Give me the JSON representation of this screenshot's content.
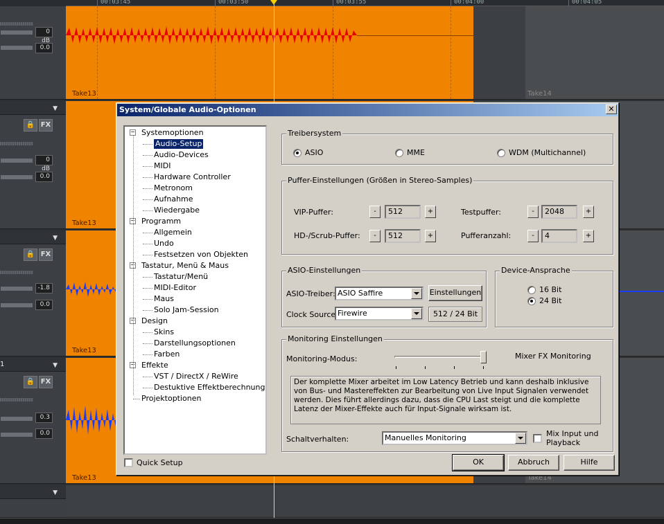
{
  "daw": {
    "ruler": [
      "00:03:45",
      "00:03:50",
      "00:03:55",
      "00:04:00",
      "00:04:05"
    ],
    "tracks": [
      {
        "label": "",
        "val1": "0 dB",
        "val2": "0.0",
        "clip": "Take13",
        "clip2": "Take14"
      },
      {
        "label": "",
        "val1": "0 dB",
        "val2": "0.0",
        "clip": "Take13",
        "clip2": ""
      },
      {
        "label": "",
        "val1": "-1.8",
        "val2": "0.0",
        "clip": "Take13",
        "clip2": ""
      },
      {
        "label": "1",
        "val1": "0.3",
        "val2": "0.0",
        "clip": "Take13",
        "clip2": "Take14"
      }
    ],
    "lock_icon": "lock-icon",
    "fx_label": "FX",
    "colors": {
      "clip": "#f08300",
      "waveform_red": "#e80000",
      "waveform_blue": "#1a3cff"
    }
  },
  "dialog": {
    "title": "System/Globale Audio-Optionen",
    "close": "✕",
    "tree": [
      {
        "label": "Systemoptionen",
        "level": 0,
        "toggle": "−"
      },
      {
        "label": "Audio-Setup",
        "level": 1,
        "selected": true
      },
      {
        "label": "Audio-Devices",
        "level": 1
      },
      {
        "label": "MIDI",
        "level": 1
      },
      {
        "label": "Hardware Controller",
        "level": 1
      },
      {
        "label": "Metronom",
        "level": 1
      },
      {
        "label": "Aufnahme",
        "level": 1
      },
      {
        "label": "Wiedergabe",
        "level": 1
      },
      {
        "label": "Programm",
        "level": 0,
        "toggle": "−"
      },
      {
        "label": "Allgemein",
        "level": 1
      },
      {
        "label": "Undo",
        "level": 1
      },
      {
        "label": "Festsetzen von Objekten",
        "level": 1
      },
      {
        "label": "Tastatur, Menü & Maus",
        "level": 0,
        "toggle": "−"
      },
      {
        "label": "Tastatur/Menü",
        "level": 1
      },
      {
        "label": "MIDI-Editor",
        "level": 1
      },
      {
        "label": "Maus",
        "level": 1
      },
      {
        "label": "Solo Jam-Session",
        "level": 1
      },
      {
        "label": "Design",
        "level": 0,
        "toggle": "−"
      },
      {
        "label": "Skins",
        "level": 1
      },
      {
        "label": "Darstellungsoptionen",
        "level": 1
      },
      {
        "label": "Farben",
        "level": 1
      },
      {
        "label": "Effekte",
        "level": 0,
        "toggle": "−"
      },
      {
        "label": "VST / DirectX / ReWire",
        "level": 1
      },
      {
        "label": "Destuktive Effektberechnung",
        "level": 1
      },
      {
        "label": "Projektoptionen",
        "level": 0
      }
    ],
    "quick_setup": "Quick Setup",
    "treiber": {
      "title": "Treibersystem",
      "asio": "ASIO",
      "mme": "MME",
      "wdm": "WDM (Multichannel)",
      "selected": "ASIO"
    },
    "puffer": {
      "title": "Puffer-Einstellungen (Größen in Stereo-Samples)",
      "vip_label": "VIP-Puffer:",
      "vip_value": "512",
      "hd_label": "HD-/Scrub-Puffer:",
      "hd_value": "512",
      "test_label": "Testpuffer:",
      "test_value": "2048",
      "anzahl_label": "Pufferanzahl:",
      "anzahl_value": "4",
      "minus": "-",
      "plus": "+"
    },
    "asio": {
      "title": "ASIO-Einstellungen",
      "treiber_label": "ASIO-Treiber:",
      "treiber_value": "ASIO Saffire",
      "einstellungen": "Einstellungen",
      "clock_label": "Clock Source:",
      "clock_value": "Firewire",
      "info": "512 / 24 Bit"
    },
    "device": {
      "title": "Device-Ansprache",
      "bit16": "16 Bit",
      "bit24": "24 Bit",
      "selected": "24 Bit"
    },
    "monitoring": {
      "title": "Monitoring Einstellungen",
      "modus_label": "Monitoring-Modus:",
      "modus_value": "Mixer FX Monitoring",
      "level": 1.0,
      "description": "Der komplette Mixer arbeitet im Low Latency Betrieb und kann deshalb inklusive von Bus- und Mastereffekten zur Bearbeitung von Live Input Signalen verwendet werden. Dies führt allerdings dazu, dass die CPU Last steigt und die komplette Latenz der Mixer-Effekte auch für Input-Signale wirksam ist.",
      "schalt_label": "Schaltverhalten:",
      "schalt_value": "Manuelles Monitoring",
      "mix_input": "Mix Input und Playback"
    },
    "buttons": {
      "ok": "OK",
      "abbruch": "Abbruch",
      "hilfe": "Hilfe"
    }
  }
}
